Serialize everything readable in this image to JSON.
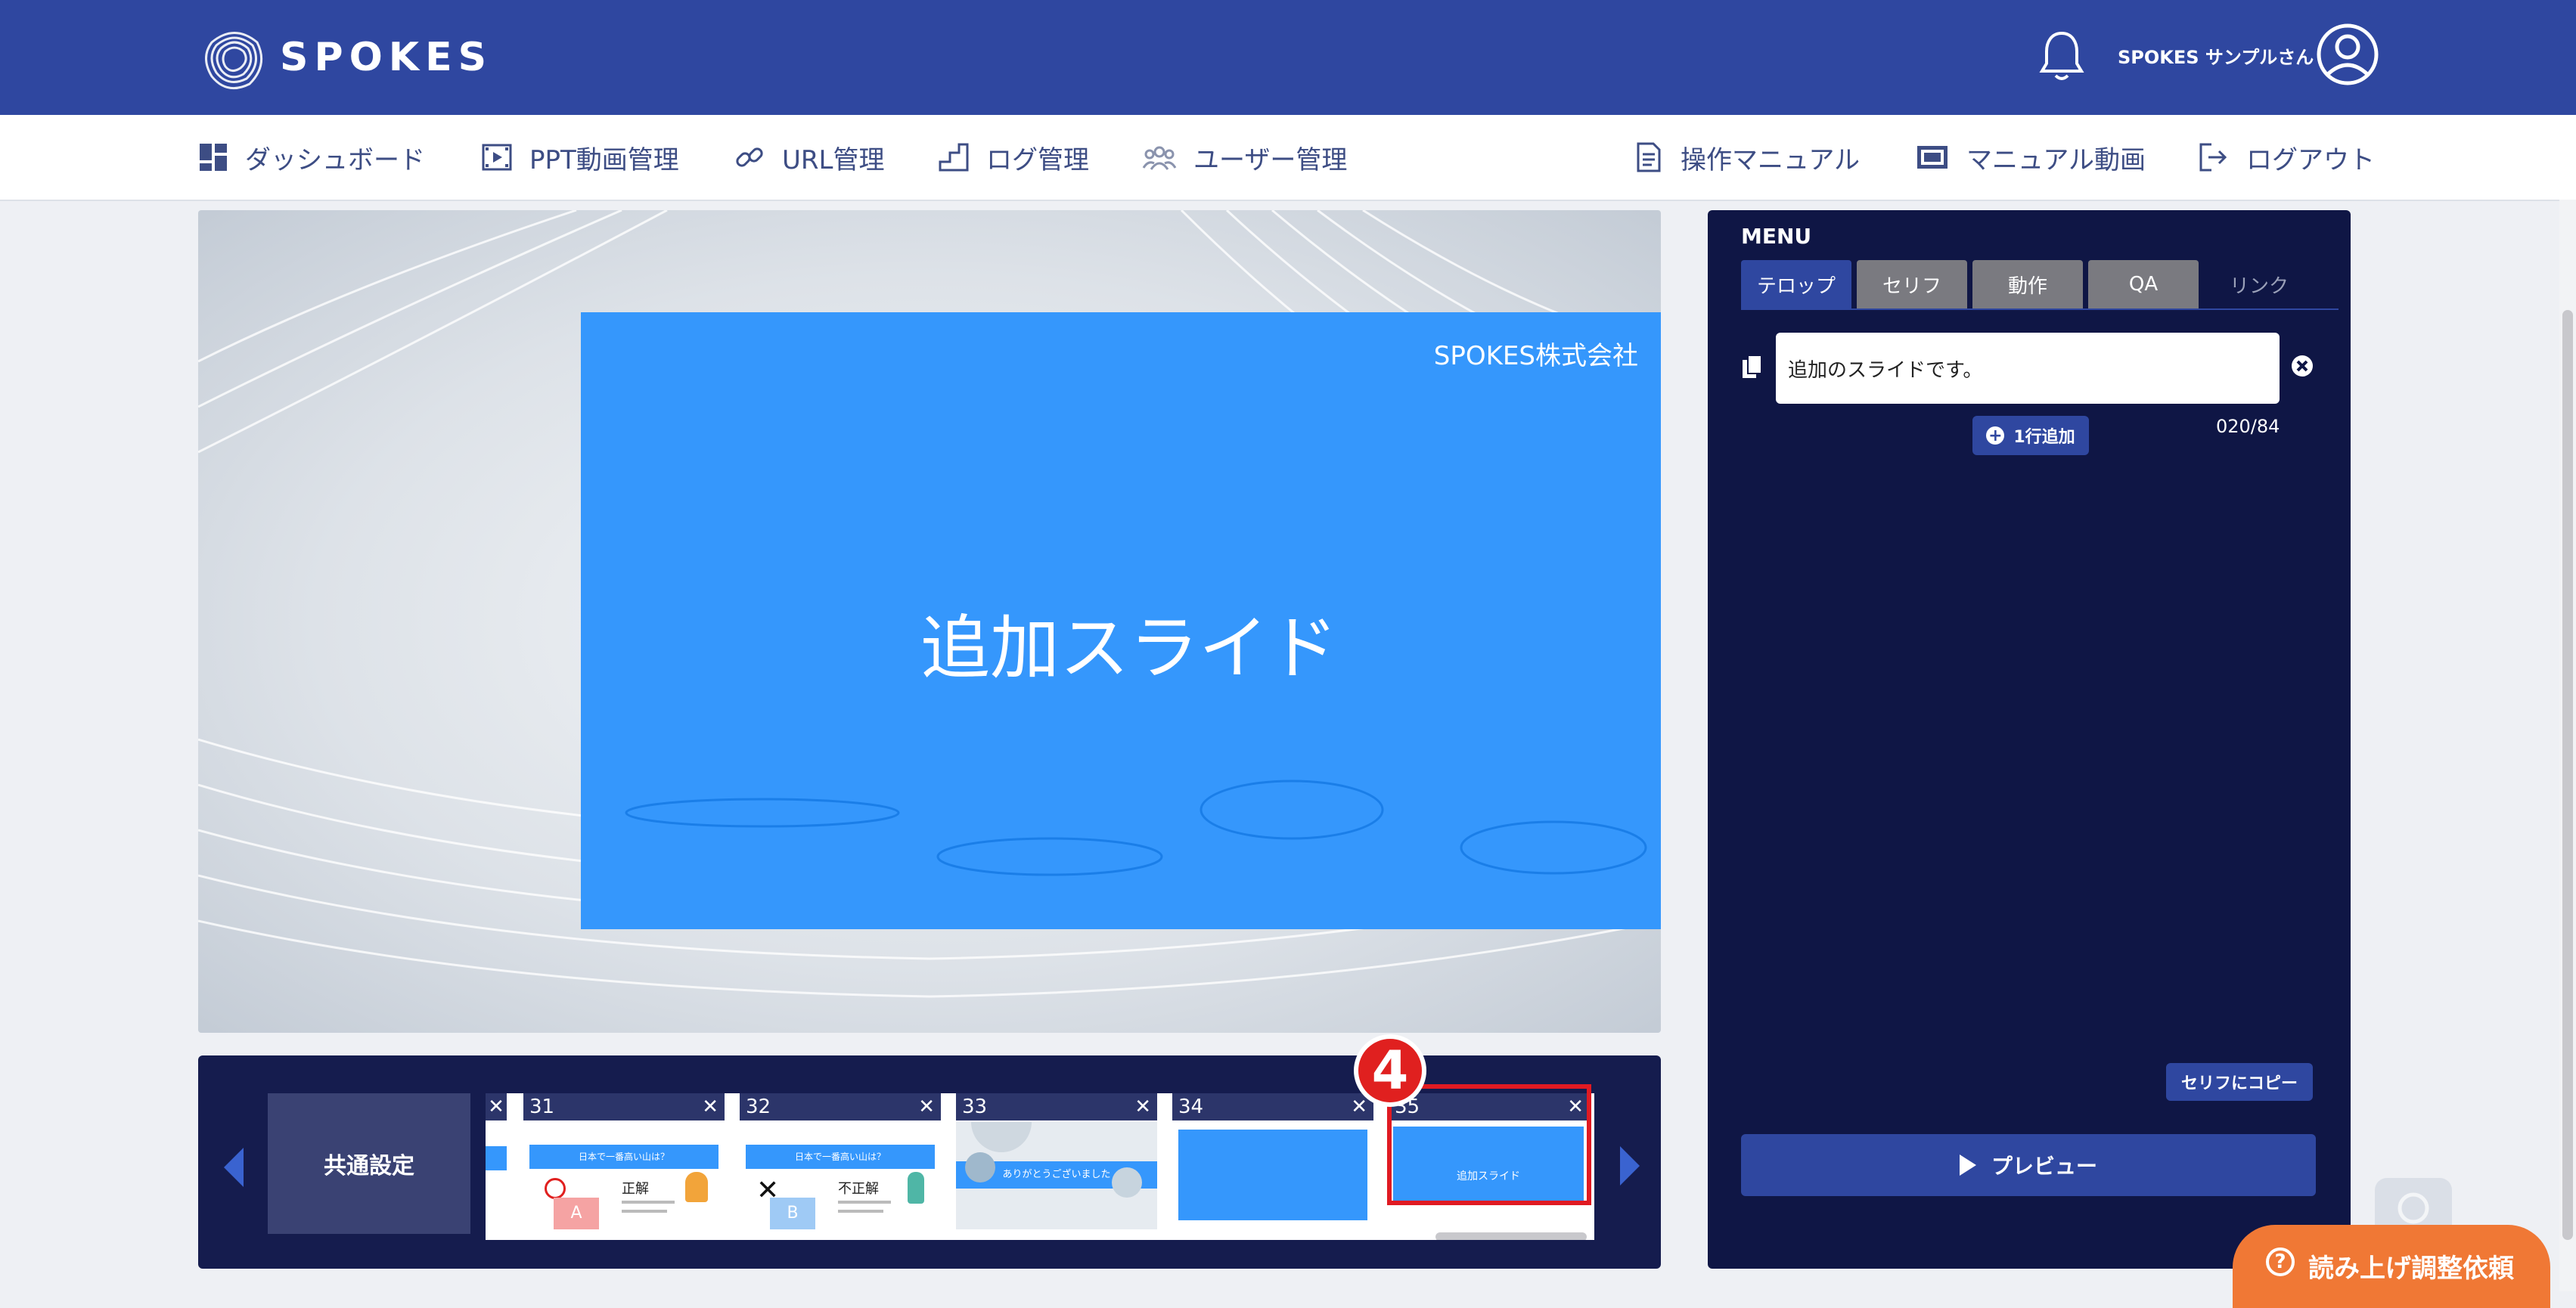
{
  "header": {
    "logo_text": "SPOKES",
    "user_name": "SPOKES サンプルさん",
    "brand_color": "#2f47a0"
  },
  "nav": {
    "items": [
      {
        "label": "ダッシュボード",
        "icon": "dashboard-icon"
      },
      {
        "label": "PPT動画管理",
        "icon": "film-icon"
      },
      {
        "label": "URL管理",
        "icon": "link-icon"
      },
      {
        "label": "ログ管理",
        "icon": "stairs-icon"
      },
      {
        "label": "ユーザー管理",
        "icon": "users-icon"
      }
    ],
    "right_items": [
      {
        "label": "操作マニュアル",
        "icon": "document-icon"
      },
      {
        "label": "マニュアル動画",
        "icon": "video-icon"
      },
      {
        "label": "ログアウト",
        "icon": "logout-icon"
      }
    ]
  },
  "slide": {
    "company": "SPOKES株式会社",
    "title": "追加スライド",
    "color": "#3597fc"
  },
  "strip": {
    "common_label": "共通設定",
    "thumbnails": [
      {
        "number": "31",
        "caption": "日本で一番高い山は？",
        "answer": "正解",
        "option": "A"
      },
      {
        "number": "32",
        "caption": "日本で一番高い山は？",
        "answer": "不正解",
        "option": "B"
      },
      {
        "number": "33",
        "caption": "ありがとうございました"
      },
      {
        "number": "34"
      },
      {
        "number": "35",
        "caption": "追加スライド"
      }
    ],
    "step_number": "4",
    "highlight_color": "#e01a22"
  },
  "panel": {
    "menu_label": "MENU",
    "tabs": [
      "テロップ",
      "セリフ",
      "動作",
      "QA",
      "リンク"
    ],
    "active_tab": "テロップ",
    "telop_value": "追加のスライドです。",
    "add_line_label": "1行追加",
    "counter": "020/84",
    "copy_to_serif_label": "セリフにコピー",
    "preview_label": "プレビュー"
  },
  "help": {
    "label": "読み上げ調整依頼",
    "color": "#f07835"
  }
}
